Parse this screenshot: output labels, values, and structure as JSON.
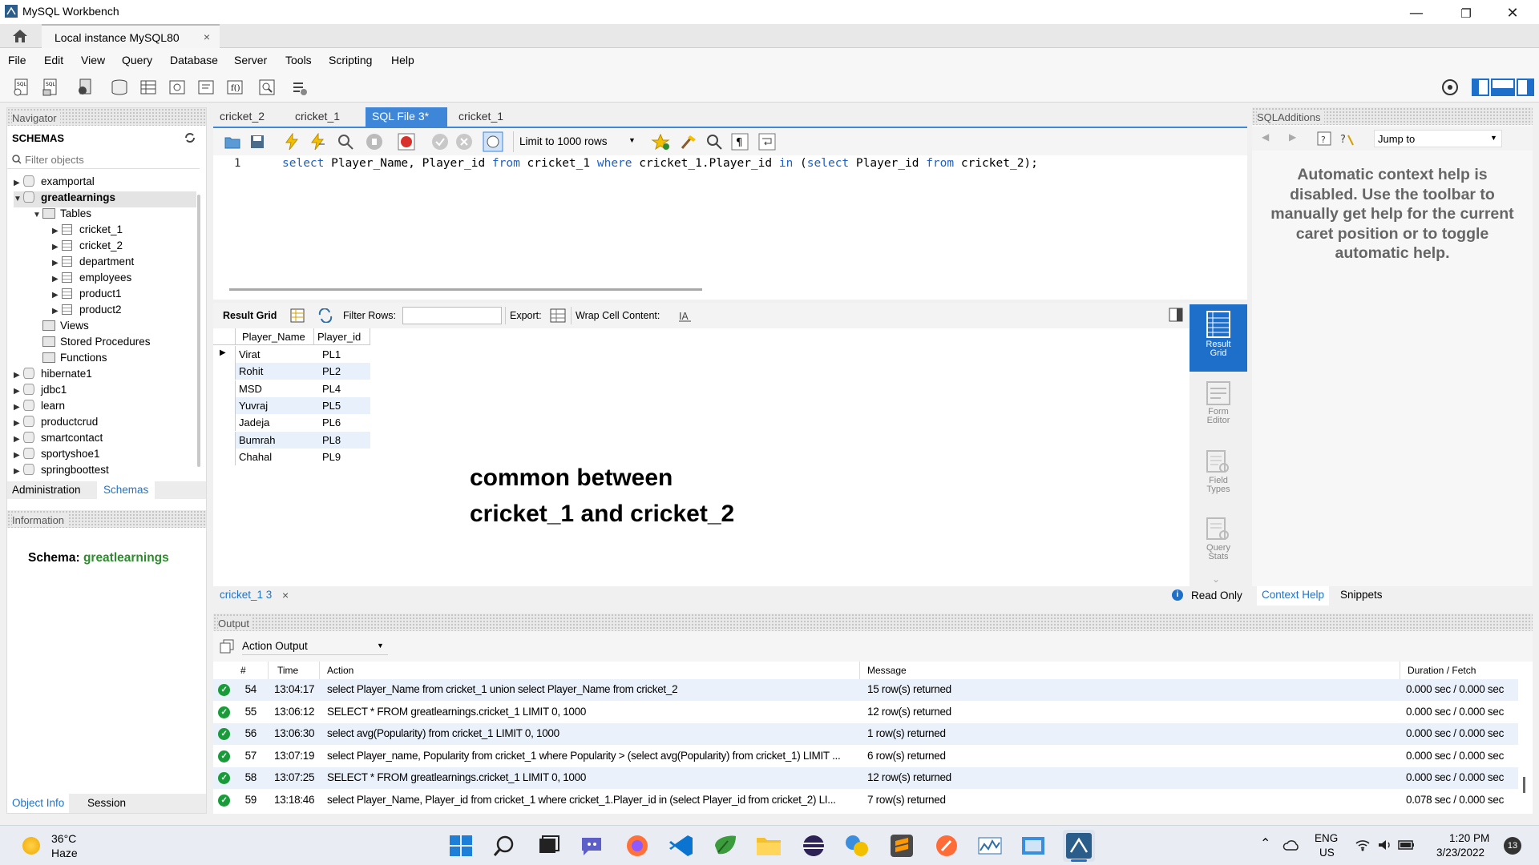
{
  "window": {
    "title": "MySQL Workbench",
    "minimize": "—",
    "restore": "❐",
    "close": "✕"
  },
  "tabs": {
    "instance": "Local instance MySQL80",
    "close": "×"
  },
  "menu": [
    "File",
    "Edit",
    "View",
    "Query",
    "Database",
    "Server",
    "Tools",
    "Scripting",
    "Help"
  ],
  "navigator": {
    "title": "Navigator",
    "schemas_label": "SCHEMAS",
    "filter_placeholder": "Filter objects",
    "items": [
      {
        "label": "examportal",
        "level": 0,
        "type": "db",
        "arrow": "▶",
        "bold": false
      },
      {
        "label": "greatlearnings",
        "level": 0,
        "type": "db",
        "arrow": "▼",
        "bold": true
      },
      {
        "label": "Tables",
        "level": 1,
        "type": "folder",
        "arrow": "▼",
        "bold": false
      },
      {
        "label": "cricket_1",
        "level": 2,
        "type": "table",
        "arrow": "▶",
        "bold": false
      },
      {
        "label": "cricket_2",
        "level": 2,
        "type": "table",
        "arrow": "▶",
        "bold": false
      },
      {
        "label": "department",
        "level": 2,
        "type": "table",
        "arrow": "▶",
        "bold": false
      },
      {
        "label": "employees",
        "level": 2,
        "type": "table",
        "arrow": "▶",
        "bold": false
      },
      {
        "label": "product1",
        "level": 2,
        "type": "table",
        "arrow": "▶",
        "bold": false
      },
      {
        "label": "product2",
        "level": 2,
        "type": "table",
        "arrow": "▶",
        "bold": false
      },
      {
        "label": "Views",
        "level": 1,
        "type": "folder",
        "arrow": "",
        "bold": false
      },
      {
        "label": "Stored Procedures",
        "level": 1,
        "type": "folder",
        "arrow": "",
        "bold": false
      },
      {
        "label": "Functions",
        "level": 1,
        "type": "folder",
        "arrow": "",
        "bold": false
      },
      {
        "label": "hibernate1",
        "level": 0,
        "type": "db",
        "arrow": "▶",
        "bold": false
      },
      {
        "label": "jdbc1",
        "level": 0,
        "type": "db",
        "arrow": "▶",
        "bold": false
      },
      {
        "label": "learn",
        "level": 0,
        "type": "db",
        "arrow": "▶",
        "bold": false
      },
      {
        "label": "productcrud",
        "level": 0,
        "type": "db",
        "arrow": "▶",
        "bold": false
      },
      {
        "label": "smartcontact",
        "level": 0,
        "type": "db",
        "arrow": "▶",
        "bold": false
      },
      {
        "label": "sportyshoe1",
        "level": 0,
        "type": "db",
        "arrow": "▶",
        "bold": false
      },
      {
        "label": "springboottest",
        "level": 0,
        "type": "db",
        "arrow": "▶",
        "bold": false
      }
    ],
    "bottom_tabs": [
      "Administration",
      "Schemas"
    ],
    "info_title": "Information",
    "schema_label": "Schema:",
    "schema_value": "greatlearnings",
    "footer_tabs": [
      "Object Info",
      "Session"
    ]
  },
  "editor": {
    "tabs": [
      "cricket_2",
      "cricket_1",
      "SQL File 3*",
      "cricket_1"
    ],
    "active_tab": 2,
    "tab_close": "×",
    "limit_label": "Limit to 1000 rows",
    "line_number": "1",
    "sql": {
      "k1": "select",
      "t1": " Player_Name, Player_id ",
      "k2": "from",
      "t2": " cricket_1 ",
      "k3": "where",
      "t3": " cricket_1.Player_id ",
      "k4": "in",
      "t4": " (",
      "k5": "select",
      "t5": " Player_id ",
      "k6": "from",
      "t6": " cricket_2);"
    }
  },
  "result": {
    "grid_label": "Result Grid",
    "filter_label": "Filter Rows:",
    "export_label": "Export:",
    "wrap_label": "Wrap Cell Content:",
    "columns": [
      "Player_Name",
      "Player_id"
    ],
    "rows": [
      [
        "Virat",
        "PL1"
      ],
      [
        "Rohit",
        "PL2"
      ],
      [
        "MSD",
        "PL4"
      ],
      [
        "Yuvraj",
        "PL5"
      ],
      [
        "Jadeja",
        "PL6"
      ],
      [
        "Bumrah",
        "PL8"
      ],
      [
        "Chahal",
        "PL9"
      ]
    ],
    "annotation_line1": "common between",
    "annotation_line2": "cricket_1 and cricket_2",
    "side_tabs": [
      {
        "line1": "Result",
        "line2": "Grid"
      },
      {
        "line1": "Form",
        "line2": "Editor"
      },
      {
        "line1": "Field",
        "line2": "Types"
      },
      {
        "line1": "Query",
        "line2": "Stats"
      }
    ],
    "result_tab": "cricket_1 3",
    "read_only": "Read Only"
  },
  "sql_additions": {
    "title": "SQLAdditions",
    "jump_to": "Jump to",
    "help_text": "Automatic context help is disabled. Use the toolbar to manually get help for the current caret position or to toggle automatic help.",
    "tabs": [
      "Context Help",
      "Snippets"
    ]
  },
  "output": {
    "title": "Output",
    "selector": "Action Output",
    "columns": [
      "#",
      "Time",
      "Action",
      "Message",
      "Duration / Fetch"
    ],
    "rows": [
      {
        "n": "54",
        "time": "13:04:17",
        "action": "select Player_Name from cricket_1  union  select Player_Name from cricket_2",
        "message": "15 row(s) returned",
        "duration": "0.000 sec / 0.000 sec"
      },
      {
        "n": "55",
        "time": "13:06:12",
        "action": "SELECT * FROM greatlearnings.cricket_1 LIMIT 0, 1000",
        "message": "12 row(s) returned",
        "duration": "0.000 sec / 0.000 sec"
      },
      {
        "n": "56",
        "time": "13:06:30",
        "action": "select avg(Popularity) from cricket_1 LIMIT 0, 1000",
        "message": "1 row(s) returned",
        "duration": "0.000 sec / 0.000 sec"
      },
      {
        "n": "57",
        "time": "13:07:19",
        "action": "select Player_name, Popularity from cricket_1 where Popularity > (select avg(Popularity) from cricket_1) LIMIT ...",
        "message": "6 row(s) returned",
        "duration": "0.000 sec / 0.000 sec"
      },
      {
        "n": "58",
        "time": "13:07:25",
        "action": "SELECT * FROM greatlearnings.cricket_1 LIMIT 0, 1000",
        "message": "12 row(s) returned",
        "duration": "0.000 sec / 0.000 sec"
      },
      {
        "n": "59",
        "time": "13:18:46",
        "action": "select Player_Name, Player_id from cricket_1 where cricket_1.Player_id in (select Player_id from cricket_2) LI...",
        "message": "7 row(s) returned",
        "duration": "0.078 sec / 0.000 sec"
      }
    ]
  },
  "taskbar": {
    "temp": "36°C",
    "weather": "Haze",
    "lang1": "ENG",
    "lang2": "US",
    "time": "1:20 PM",
    "date": "3/23/2022",
    "notif": "13"
  },
  "colors": {
    "accent": "#3d86d8",
    "green": "#2e8b2e",
    "keyword": "#1e61c9"
  }
}
